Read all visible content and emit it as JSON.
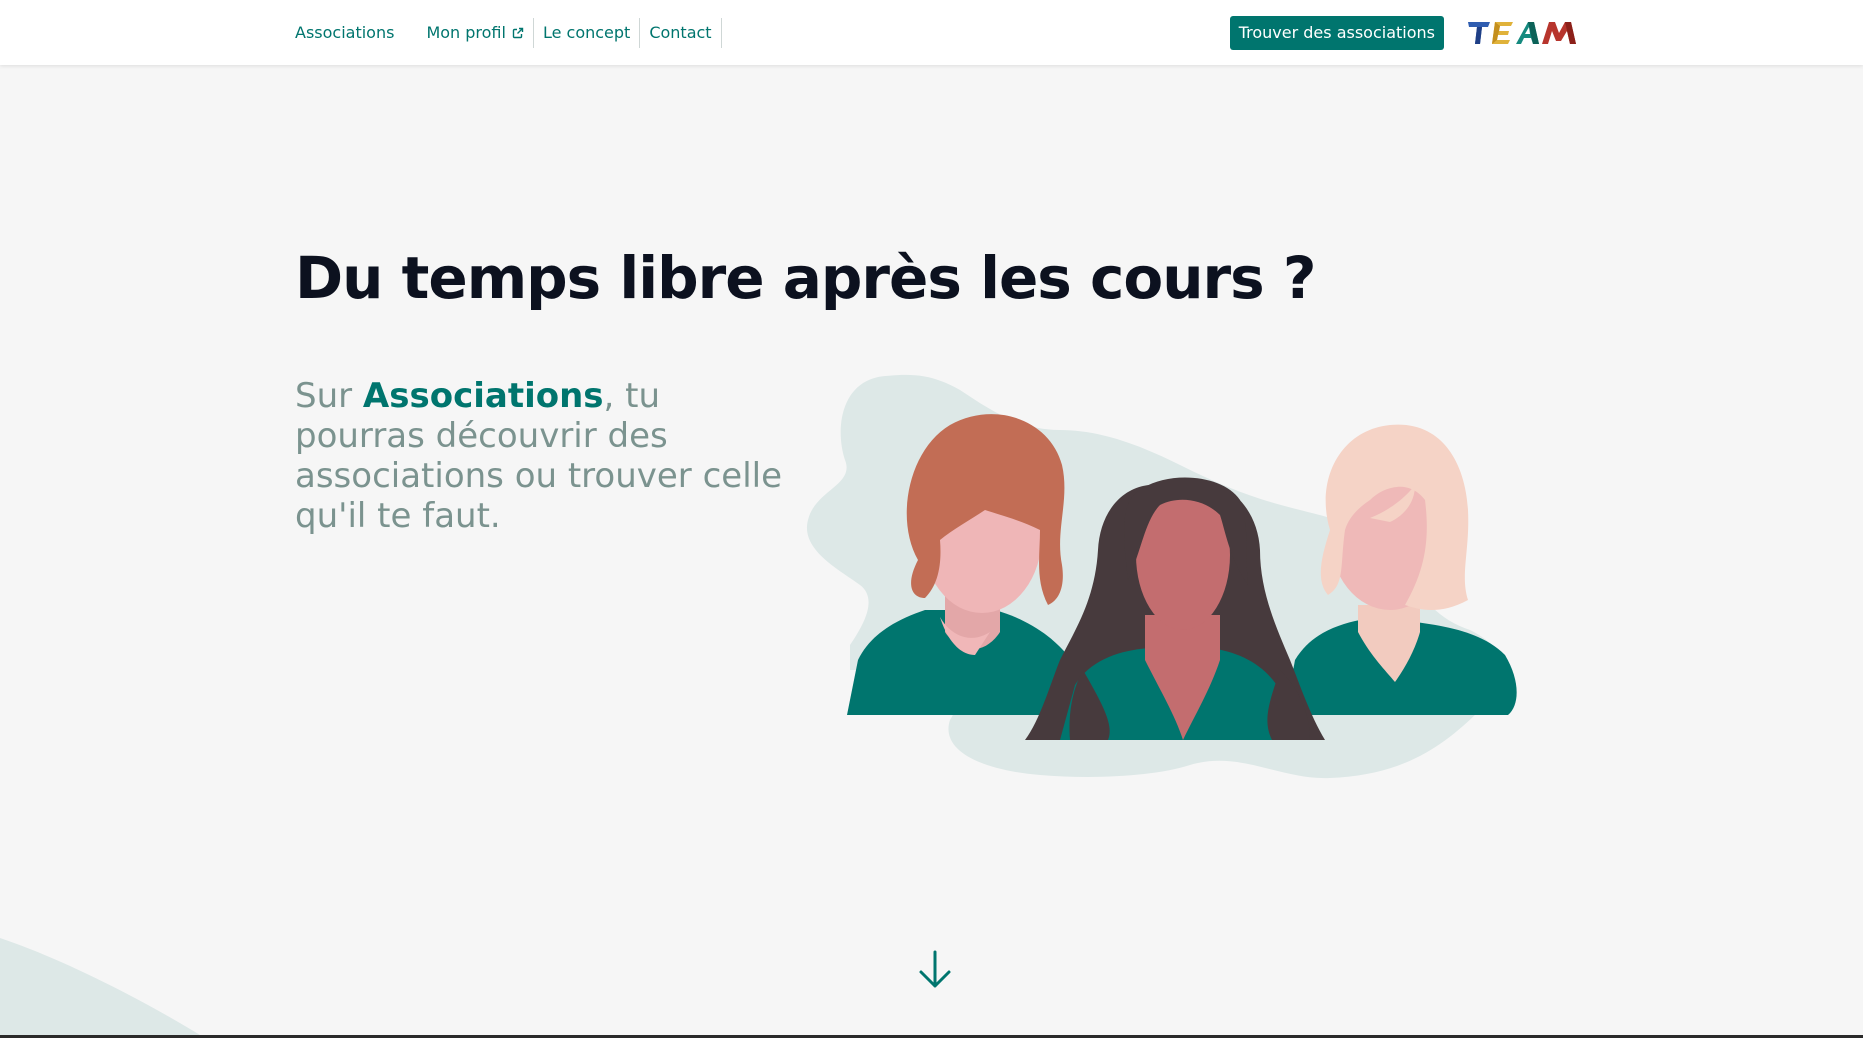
{
  "nav": {
    "links": [
      {
        "label": "Associations"
      },
      {
        "label": "Mon profil"
      },
      {
        "label": "Le concept"
      },
      {
        "label": "Contact"
      }
    ],
    "external_icon": "external-link-icon",
    "cta_label": "Trouver des associations",
    "logo_text": "TEAM"
  },
  "hero": {
    "title": "Du temps libre après les cours ?",
    "text_before": "Sur ",
    "text_brand": "Associations",
    "text_after": ", tu pourras découvrir des associations ou trouver celle qu'il te faut."
  },
  "scroll_icon": "arrow-down-icon",
  "colors": {
    "primary": "#00756e",
    "background": "#f6f6f6",
    "title": "#0c111f",
    "muted_text": "#7b938f",
    "blob": "#dde8e7"
  }
}
